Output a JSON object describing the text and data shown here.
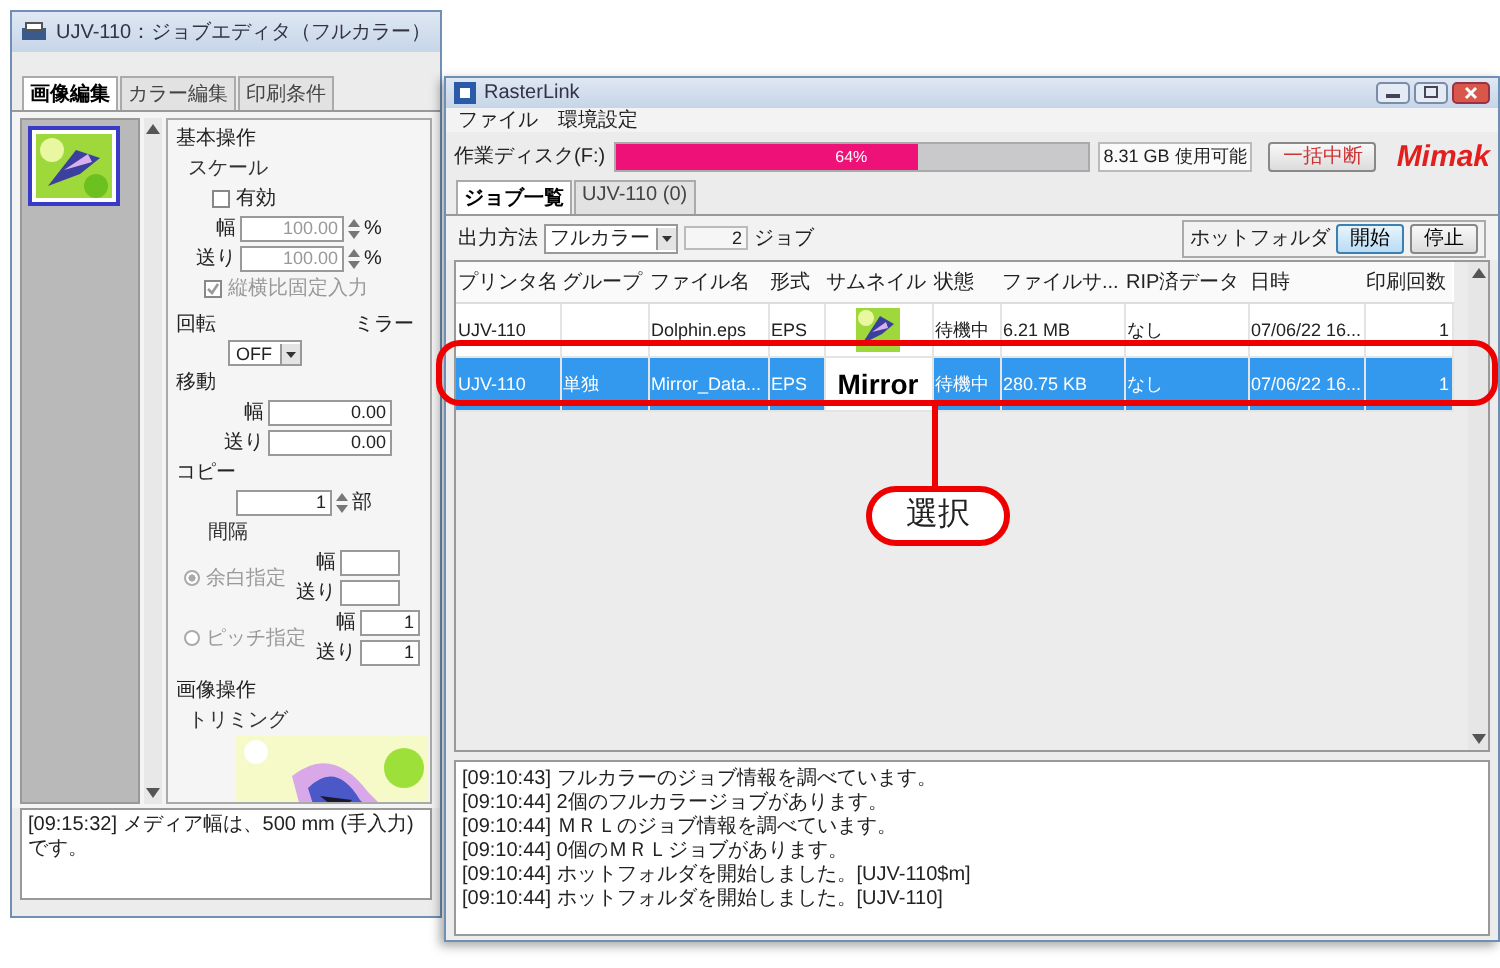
{
  "editor": {
    "title": "UJV-110：ジョブエディタ（フルカラー）",
    "tabs": [
      {
        "label": "画像編集",
        "selected": true
      },
      {
        "label": "カラー編集",
        "selected": false
      },
      {
        "label": "印刷条件",
        "selected": false
      }
    ],
    "thumbnails": [
      {
        "kind": "picture",
        "selected": true
      }
    ],
    "basic": {
      "heading": "基本操作",
      "scale": {
        "label": "スケール",
        "enable": {
          "label": "有効",
          "checked": false
        },
        "width": {
          "label": "幅",
          "value": "100.00",
          "unit": "%"
        },
        "feed": {
          "label": "送り",
          "value": "100.00",
          "unit": "%"
        },
        "lock": {
          "label": "縦横比固定入力",
          "checked": true
        }
      },
      "rotate": {
        "label": "回転",
        "value": "OFF"
      },
      "mirror": {
        "label": "ミラー"
      },
      "move": {
        "label": "移動",
        "width": {
          "label": "幅",
          "value": "0.00"
        },
        "feed": {
          "label": "送り",
          "value": "0.00"
        }
      },
      "copy": {
        "label": "コピー",
        "value": "1",
        "unit": "部",
        "spacing": "間隔",
        "disabled": true,
        "options": [
          {
            "label": "余白指定",
            "selected": true,
            "width": {
              "label": "幅"
            },
            "feed": {
              "label": "送り"
            }
          },
          {
            "label": "ピッチ指定",
            "selected": false,
            "width": {
              "label": "幅",
              "value": "1"
            },
            "feed": {
              "label": "送り",
              "value": "1"
            }
          }
        ]
      }
    },
    "image": {
      "heading": "画像操作",
      "trimming": "トリミング",
      "preview": {
        "kind": "picture"
      }
    },
    "log": [
      "[09:15:32] メディア幅は、500 mm (手入力) です。"
    ]
  },
  "rasterlink": {
    "title": "RasterLink",
    "menu": [
      "ファイル",
      "環境設定"
    ],
    "disk": {
      "label": "作業ディスク(F:)",
      "level": 0.64,
      "percent": "64%",
      "free": "8.31 GB 使用可能"
    },
    "stop_all": "一括中断",
    "logo": "Mimak",
    "tabs": [
      {
        "label": "ジョブ一覧",
        "selected": true
      },
      {
        "label": "UJV-110 (0)",
        "selected": false
      }
    ],
    "output": {
      "label": "出力方法",
      "value": "フルカラー",
      "count": "2",
      "unit": "ジョブ"
    },
    "hot_folder": {
      "label": "ホットフォルダ",
      "buttons": [
        {
          "label": "開始",
          "active": true
        },
        {
          "label": "停止",
          "active": false
        }
      ]
    },
    "table": {
      "columns": [
        "プリンタ名",
        "グループ",
        "ファイル名",
        "形式",
        "サムネイル",
        "状態",
        "ファイルサ...",
        "RIP済データ",
        "日時",
        "印刷回数"
      ],
      "rows": [
        {
          "selected": false,
          "printer": "UJV-110",
          "file": "Dolphin.eps",
          "format": "EPS",
          "thumbnail": {
            "kind": "picture"
          },
          "status": "待機中",
          "size": "6.21 MB",
          "rip": "なし",
          "date": "07/06/22 16...",
          "copies": "1"
        },
        {
          "selected": true,
          "printer": "UJV-110",
          "group": "単独",
          "file": "Mirror_Data...",
          "format": "EPS",
          "thumbnail": {
            "kind": "text",
            "text": "Mirror"
          },
          "status": "待機中",
          "size": "280.75 KB",
          "rip": "なし",
          "date": "07/06/22 16...",
          "copies": "1"
        }
      ]
    },
    "log": [
      "[09:10:43] フルカラーのジョブ情報を調べています。",
      "[09:10:44] 2個のフルカラージョブがあります。",
      "[09:10:44] ＭＲＬのジョブ情報を調べています。",
      "[09:10:44] 0個のＭＲＬジョブがあります。",
      "[09:10:44] ホットフォルダを開始しました。[UJV-110$m]",
      "[09:10:44] ホットフォルダを開始しました。[UJV-110]"
    ]
  },
  "callout": {
    "label": "選択"
  }
}
